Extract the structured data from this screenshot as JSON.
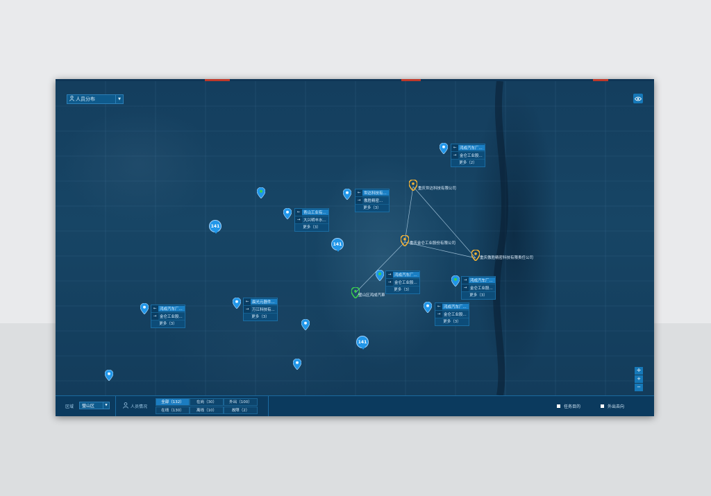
{
  "layer_select": {
    "label": "人员分布"
  },
  "bottom": {
    "region_label": "区域",
    "region_value": "璧山区",
    "personnel_label": "人员情况",
    "status": [
      {
        "label": "全部（132）",
        "active": true
      },
      {
        "label": "在岗（30）",
        "active": false
      },
      {
        "label": "外出（100）",
        "active": false
      },
      {
        "label": "在线（130）",
        "active": false
      },
      {
        "label": "离线（10）",
        "active": false
      },
      {
        "label": "故障（2）",
        "active": false
      }
    ],
    "legend": [
      {
        "label": "任务目的"
      },
      {
        "label": "外出去向"
      }
    ]
  },
  "clusters": [
    {
      "count": "141"
    },
    {
      "count": "141"
    },
    {
      "count": "141"
    }
  ],
  "companies": [
    {
      "label": "重庆世达科技有限公司"
    },
    {
      "label": "重庆金仑工业股份有限公司"
    },
    {
      "label": "重庆傲胜精密科技有限责任公司"
    },
    {
      "label": "璧山区鸿成汽車"
    }
  ],
  "popups": [
    {
      "rows": [
        "鸿成汽车厂...",
        "金仑工业股..."
      ],
      "more": "更多（2）"
    },
    {
      "rows": [
        "世达科技有...",
        "傲胜精密..."
      ],
      "more": "更多（3）"
    },
    {
      "rows": [
        "青山工业有...",
        "大兴明丰水..."
      ],
      "more": "更多（3）"
    },
    {
      "rows": [
        "鸿成汽车厂...",
        "金仑工业股..."
      ],
      "more": "更多（3）"
    },
    {
      "rows": [
        "鸿成汽车厂...",
        "金仑工业股..."
      ],
      "more": "更多（3）"
    },
    {
      "rows": [
        "鸿成汽车厂...",
        "金仑工业股..."
      ],
      "more": "更多（3）"
    },
    {
      "rows": [
        "鸿成汽车厂...",
        "金仑工业股..."
      ],
      "more": "更多（3）"
    },
    {
      "rows": [
        "晨光元器件...",
        "万江科技有..."
      ],
      "more": "更多（3）"
    }
  ],
  "zoom": {
    "locate": "✛",
    "in": "+",
    "out": "−"
  },
  "colors": {
    "accent": "#1678b8",
    "marker_blue": "#2196e8",
    "marker_yellow": "#f5b335",
    "marker_green": "#3ccf4e"
  }
}
